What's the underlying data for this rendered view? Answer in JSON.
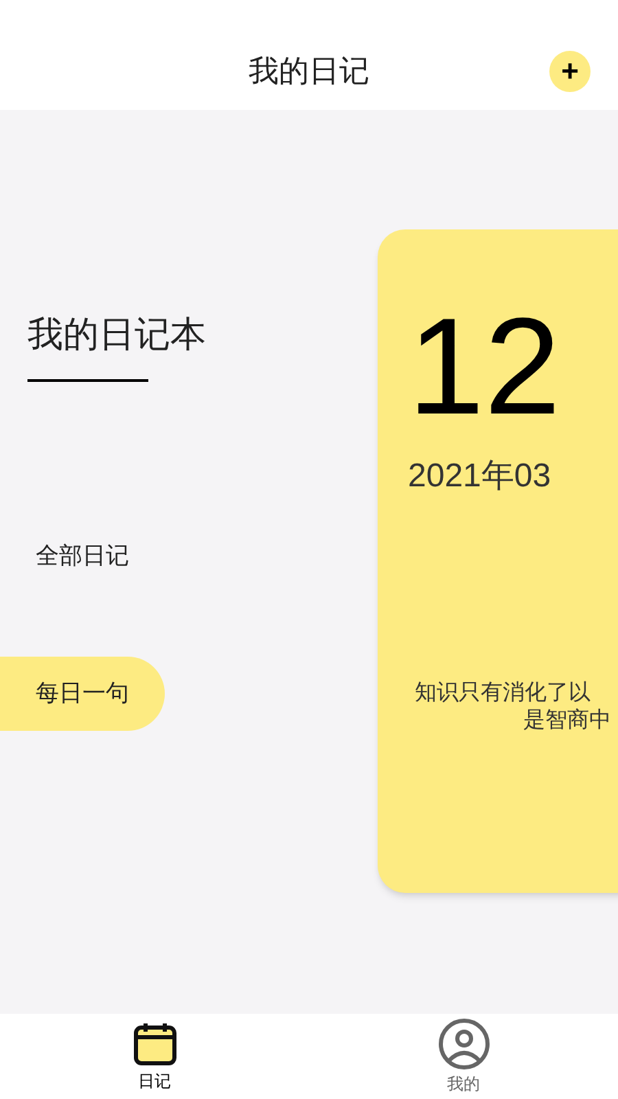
{
  "header": {
    "title": "我的日记",
    "add_button": "+"
  },
  "sidebar": {
    "notebook_title": "我的日记本",
    "menu": [
      {
        "label": "全部日记",
        "selected": false
      },
      {
        "label": "每日一句",
        "selected": true
      }
    ]
  },
  "card": {
    "day": "12",
    "year_month": "2021年03",
    "quote_lines": [
      "知识只有消化了以",
      "是智商中"
    ]
  },
  "tab_bar": [
    {
      "label": "日记",
      "kind": "calendar",
      "selected": true
    },
    {
      "label": "我的",
      "kind": "person",
      "selected": false
    }
  ]
}
